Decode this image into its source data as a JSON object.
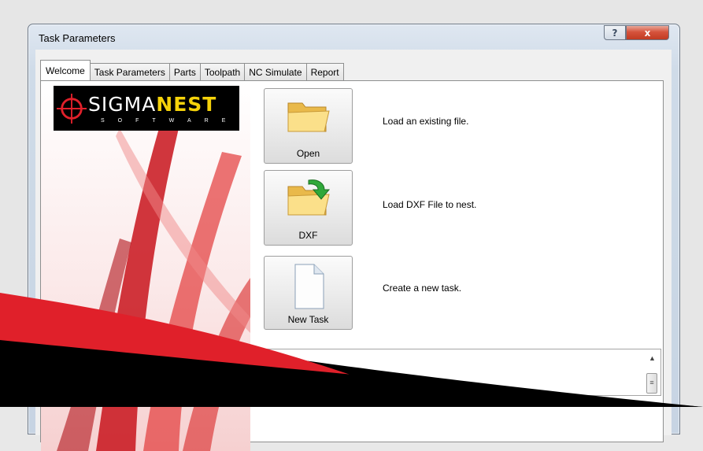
{
  "window": {
    "title": "Task Parameters",
    "help_label": "?",
    "close_label": "x"
  },
  "tabs": [
    {
      "label": "Welcome",
      "active": true
    },
    {
      "label": "Task Parameters",
      "active": false
    },
    {
      "label": "Parts",
      "active": false
    },
    {
      "label": "Toolpath",
      "active": false
    },
    {
      "label": "NC Simulate",
      "active": false
    },
    {
      "label": "Report",
      "active": false
    }
  ],
  "logo": {
    "word_part1": "SIGMA",
    "word_part2": "NEST",
    "sub": "SOFTWARE"
  },
  "actions": [
    {
      "label": "Open",
      "description": "Load an existing file.",
      "icon": "folder-icon"
    },
    {
      "label": "DXF",
      "description": "Load DXF File to nest.",
      "icon": "folder-import-icon"
    },
    {
      "label": "New Task",
      "description": "Create a new task.",
      "icon": "new-document-icon"
    }
  ],
  "log": {
    "scroll_up_glyph": "▲",
    "scroll_thumb_glyph": "≡"
  },
  "colors": {
    "accent_red": "#e0202a",
    "logo_yellow": "#f5d20a",
    "titlebar": "#cfdbe8",
    "close_red": "#c13b22"
  }
}
